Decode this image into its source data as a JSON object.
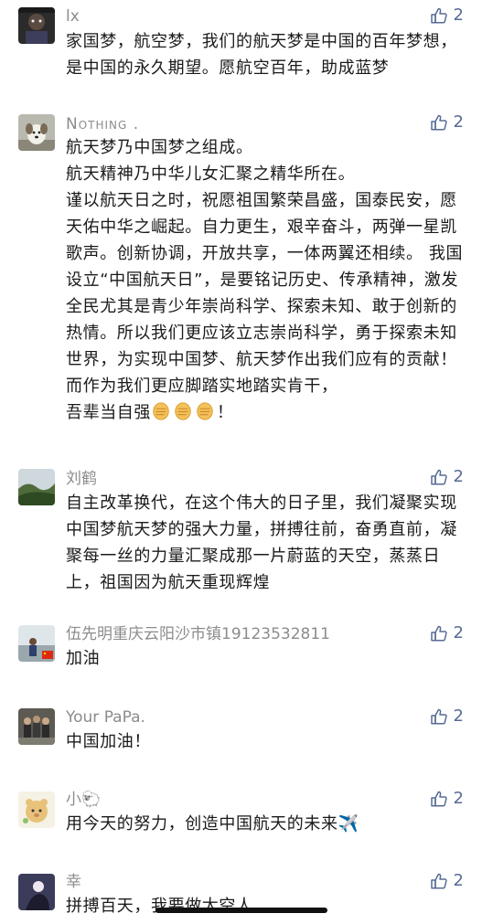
{
  "comments": [
    {
      "name": "lx",
      "likes": "2",
      "avatar": "dark-portrait-avatar",
      "lines": [
        "家国梦，航空梦，我们的航天梦是中国的百年梦想，是中国的永久期望。愿航空百年，助成蓝梦"
      ]
    },
    {
      "name": "Nothing .",
      "likes": "2",
      "avatar": "dog-avatar",
      "lines": [
        "航天梦乃中国梦之组成。",
        "航天精神乃中华儿女汇聚之精华所在。",
        "谨以航天日之时，祝愿祖国繁荣昌盛，国泰民安，愿天佑中华之崛起。自力更生，艰辛奋斗，两弹一星凯歌声。创新协调，开放共享，一体两翼还相续。 我国设立“中国航天日”，是要铭记历史、传承精神，激发全民尤其是青少年崇尚科学、探索未知、敢于创新的热情。所以我们更应该立志崇尚科学，勇于探索未知世界，为实现中国梦、航天梦作出我们应有的贡献！而作为我们更应脚踏实地踏实肯干，"
      ],
      "last_line": "吾辈当自强",
      "last_line_end": "！",
      "fist_emoji": "✊"
    },
    {
      "name": "刘鹤",
      "likes": "2",
      "avatar": "landscape-avatar",
      "lines": [
        "自主改革换代，在这个伟大的日子里，我们凝聚实现中国梦航天梦的强大力量，拼搏往前，奋勇直前，凝聚每一丝的力量汇聚成那一片蔚蓝的天空，蒸蒸日上，祖国因为航天重现辉煌"
      ]
    },
    {
      "name": "伍先明重庆云阳沙市镇19123532811",
      "likes": "2",
      "avatar": "flag-person-avatar",
      "lines": [
        "加油"
      ]
    },
    {
      "name": "Your PaPa.",
      "likes": "2",
      "avatar": "group-photo-avatar",
      "lines": [
        "中国加油！"
      ]
    },
    {
      "name": "小🐑",
      "likes": "2",
      "avatar": "cartoon-avatar",
      "lines": [
        "用今天的努力，创造中国航天的未来✈️"
      ]
    },
    {
      "name": "幸",
      "likes": "2",
      "avatar": "silhouette-avatar",
      "lines": [
        "拼搏百天，我要做太空人"
      ]
    }
  ],
  "colors": {
    "like": "#576b95",
    "name": "#8c8c8c",
    "text": "#1a1a1a"
  }
}
